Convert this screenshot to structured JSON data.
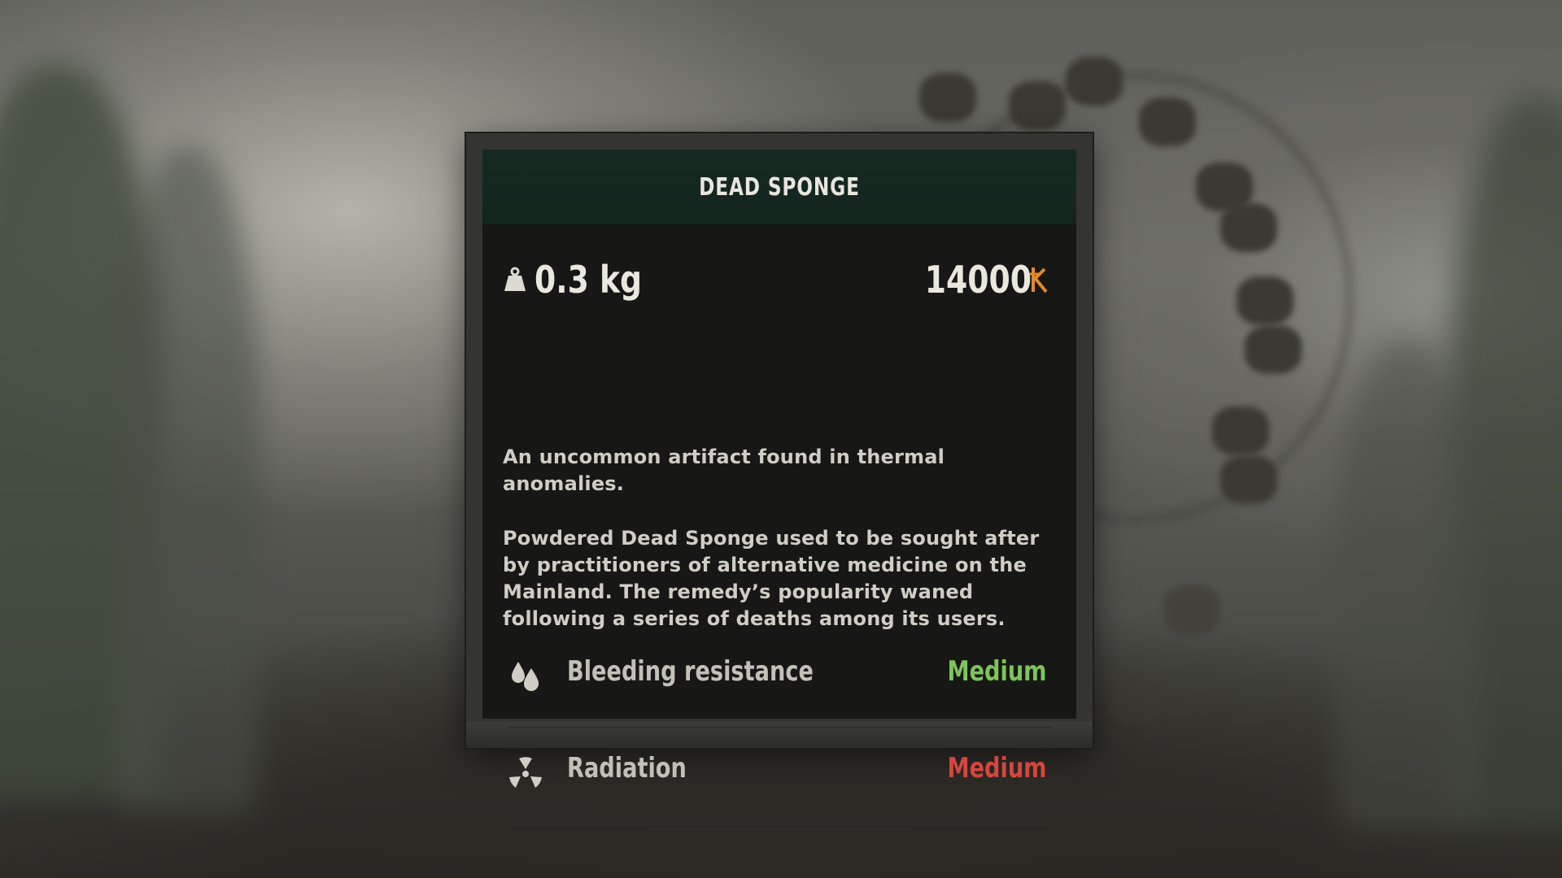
{
  "item": {
    "title": "DEAD SPONGE",
    "weight": "0.3 kg",
    "price": "14000",
    "description": [
      "An uncommon artifact found in thermal anomalies.",
      "Powdered Dead Sponge used to be sought after by practitioners of alternative medicine on the Mainland. The remedy’s popularity waned following a series of deaths among its users."
    ],
    "stats": [
      {
        "label": "Bleeding resistance",
        "value": "Medium",
        "icon": "blood-drops-icon",
        "color": "#7dc45a"
      },
      {
        "label": "Radiation",
        "value": "Medium",
        "icon": "radiation-icon",
        "color": "#d4463f"
      }
    ]
  },
  "icons": {
    "weight": "weight-icon",
    "currency": "coupon-currency-icon"
  },
  "colors": {
    "header_bg": "#162a22",
    "panel_bg": "#171716",
    "frame": "#343431",
    "currency_accent": "#e08a2e",
    "positive": "#7dc45a",
    "negative": "#d4463f"
  }
}
